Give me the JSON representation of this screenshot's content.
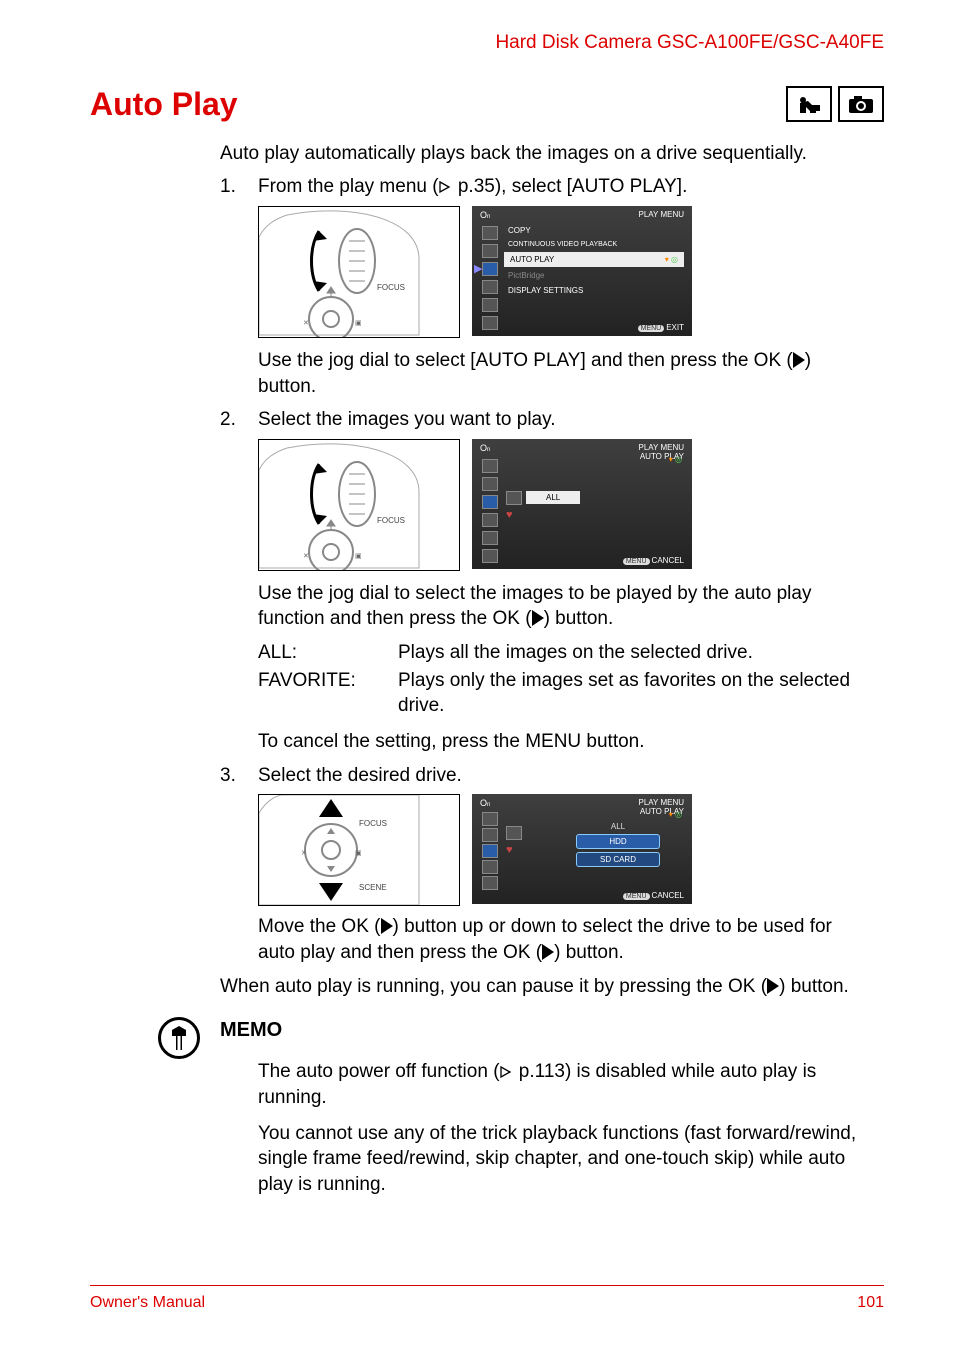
{
  "header": "Hard Disk Camera GSC-A100FE/GSC-A40FE",
  "title": "Auto Play",
  "intro": "Auto play automatically plays back the images on a drive sequentially.",
  "steps": {
    "s1": {
      "num": "1.",
      "text_before": "From the play menu (",
      "text_ref": " p.35), select [AUTO PLAY].",
      "after": "Use the jog dial to select [AUTO PLAY] and then press the OK (",
      "after2": ") button."
    },
    "s2": {
      "num": "2.",
      "text": "Select the images you want to play.",
      "after_a": "Use the jog dial to select the images to be played by the auto play function and then press the OK (",
      "after_b": ") button.",
      "cancel": "To cancel the setting, press the MENU button."
    },
    "s3": {
      "num": "3.",
      "text": "Select the desired drive.",
      "after_a": "Move the OK (",
      "after_b": ") button up or down to select the drive to be used for auto play and then press the OK (",
      "after_c": ") button."
    },
    "pause_a": "When auto play is running, you can pause it by pressing the OK (",
    "pause_b": ") button."
  },
  "defs": {
    "all_term": "ALL:",
    "all_desc": "Plays all the images on the selected drive.",
    "fav_term": "FAVORITE:",
    "fav_desc": "Plays only the images set as favorites on the selected drive."
  },
  "memo": {
    "heading": "MEMO",
    "p1_a": "The auto power off function (",
    "p1_b": " p.113) is disabled while auto play is running.",
    "p2": "You cannot use any of the trick playback functions (fast forward/rewind, single frame feed/rewind, skip chapter, and one-touch skip) while auto play is running."
  },
  "jog": {
    "focus": "FOCUS",
    "scene": "SCENE"
  },
  "screens": {
    "play_menu": {
      "title": "PLAY MENU",
      "items": [
        "COPY",
        "CONTINUOUS VIDEO PLAYBACK",
        "AUTO PLAY",
        "PictBridge",
        "DISPLAY SETTINGS"
      ],
      "footer_btn": "MENU",
      "footer": "EXIT"
    },
    "autoplay_sel": {
      "title1": "PLAY MENU",
      "title2": "AUTO PLAY",
      "item_all": "ALL",
      "footer_btn": "MENU",
      "footer": "CANCEL"
    },
    "drive_sel": {
      "title1": "PLAY MENU",
      "title2": "AUTO PLAY",
      "items": [
        "ALL",
        "HDD",
        "SD CARD"
      ],
      "footer_btn": "MENU",
      "footer": "CANCEL"
    }
  },
  "footer": {
    "left": "Owner's Manual",
    "right": "101"
  }
}
